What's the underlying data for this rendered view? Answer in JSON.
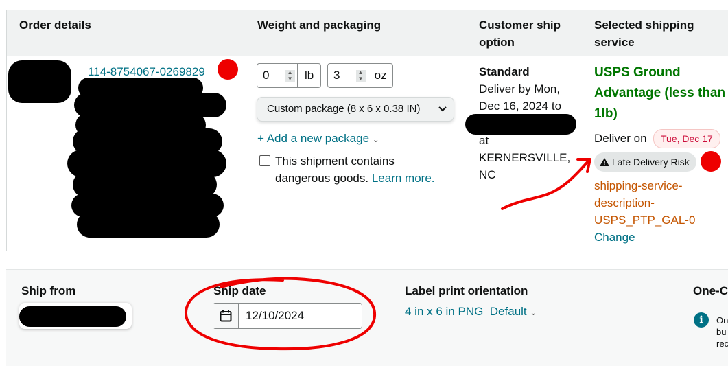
{
  "table": {
    "headers": {
      "order_details": "Order details",
      "weight_packaging": "Weight and packaging",
      "customer_ship_option_l1": "Customer ship",
      "customer_ship_option_l2": "option",
      "selected_service_l1": "Selected shipping",
      "selected_service_l2": "service"
    },
    "order_id": "114-8754067-0269829",
    "weight": {
      "lb_value": "0",
      "lb_unit": "lb",
      "oz_value": "3",
      "oz_unit": "oz"
    },
    "package_select": "Custom package (8 x 6 x 0.38 IN)",
    "add_package": "+ Add a new package",
    "dangerous_l1": "This shipment contains",
    "dangerous_l2": "dangerous goods.",
    "learn_more": "Learn more.",
    "ship_option": {
      "title": "Standard",
      "l1": "Deliver by Mon,",
      "l2": "Dec 16, 2024 to",
      "at": "at",
      "city": "KERNERSVILLE,",
      "state": "NC"
    },
    "service": {
      "name_l1": "USPS Ground",
      "name_l2": "Advantage (less than",
      "name_l3": "1lb)",
      "deliver_on": "Deliver on",
      "deliver_date": "Tue, Dec 17",
      "risk": "Late Delivery Risk",
      "desc_l1": "shipping-service-",
      "desc_l2": "description-",
      "desc_l3": "USPS_PTP_GAL-0",
      "change": "Change"
    }
  },
  "bottom": {
    "ship_from": "Ship from",
    "ship_date": "Ship date",
    "ship_date_value": "12/10/2024",
    "label_orientation": "Label print orientation",
    "label_format": "4 in x 6 in PNG",
    "label_default": "Default",
    "one_click": "One-C",
    "side_note_l1": "On",
    "side_note_l2": "bu",
    "side_note_l3": "rec"
  },
  "colors": {
    "link": "#007185",
    "green_service": "#007600",
    "orange_desc": "#c45500",
    "annotation_red": "#e00000"
  }
}
